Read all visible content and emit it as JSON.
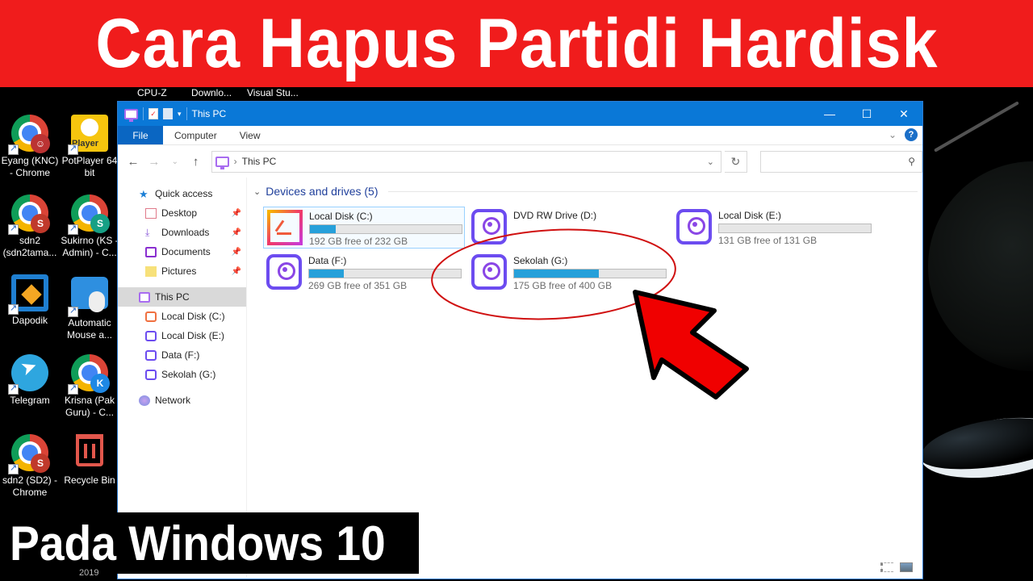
{
  "banner": {
    "title": "Cara Hapus Partidi Hardisk",
    "caption": "Pada Windows 10",
    "ghost_text": "2019"
  },
  "top_labels": [
    "CPU-Z",
    "Downlo...",
    "Visual Stu..."
  ],
  "desktop": {
    "icons": [
      {
        "label": "Eyang (KNC) - Chrome",
        "icon": "chrome-icon",
        "badge": ""
      },
      {
        "label": "PotPlayer 64 bit",
        "icon": "potplayer-icon"
      },
      {
        "label": "sdn2 (sdn2tama...",
        "icon": "chrome-icon",
        "badge": "S"
      },
      {
        "label": "Sukirno (KS - Admin) - C...",
        "icon": "chrome-icon",
        "badge": "S"
      },
      {
        "label": "Dapodik",
        "icon": "dapodik-icon"
      },
      {
        "label": "Automatic Mouse a...",
        "icon": "keyboard-mouse-icon"
      },
      {
        "label": "Telegram",
        "icon": "telegram-icon"
      },
      {
        "label": "Krisna (Pak Guru) - C...",
        "icon": "chrome-icon",
        "badge": "K"
      },
      {
        "label": "sdn2 (SD2) - Chrome",
        "icon": "chrome-icon",
        "badge": "S"
      },
      {
        "label": "Recycle Bin",
        "icon": "recycle-bin-icon"
      }
    ],
    "badge_colors": {
      "s_red": "#c0392b",
      "s_teal": "#16a085",
      "k_blue": "#1e88e5"
    }
  },
  "explorer": {
    "title": "This PC",
    "window_buttons": {
      "minimize": "—",
      "maximize": "☐",
      "close": "✕"
    },
    "ribbon": {
      "file": "File",
      "tabs": [
        "Computer",
        "View"
      ],
      "help": "?"
    },
    "nav": {
      "back": "←",
      "forward": "→",
      "recent": "⌄",
      "up": "↑",
      "address": "This PC",
      "address_sep": "›",
      "refresh": "↻",
      "search_placeholder": "",
      "search_icon": "⚲"
    },
    "sidebar": {
      "quick_access": "Quick access",
      "quick_items": [
        "Desktop",
        "Downloads",
        "Documents",
        "Pictures"
      ],
      "this_pc": "This PC",
      "drives": [
        "Local Disk (C:)",
        "Local Disk (E:)",
        "Data (F:)",
        "Sekolah (G:)"
      ],
      "network": "Network"
    },
    "group": {
      "label": "Devices and drives (5)"
    },
    "drives": [
      {
        "name": "Local Disk (C:)",
        "free": "192 GB free of 232 GB",
        "used_fraction": 0.17,
        "type": "system"
      },
      {
        "name": "DVD RW Drive (D:)",
        "free": "",
        "used_fraction": null,
        "type": "dvd"
      },
      {
        "name": "Local Disk (E:)",
        "free": "131 GB free of 131 GB",
        "used_fraction": 0.0,
        "type": "disk"
      },
      {
        "name": "Data (F:)",
        "free": "269 GB free of 351 GB",
        "used_fraction": 0.23,
        "type": "disk"
      },
      {
        "name": "Sekolah (G:)",
        "free": "175 GB free of 400 GB",
        "used_fraction": 0.56,
        "type": "disk"
      }
    ],
    "colors": {
      "titlebar": "#0a78d7",
      "file_tab": "#0a66c2",
      "bar_fill": "#26a0da",
      "group_header": "#1f3f9b"
    }
  },
  "annotation": {
    "circle_color": "#d01010",
    "arrow_color": "#f00000"
  }
}
